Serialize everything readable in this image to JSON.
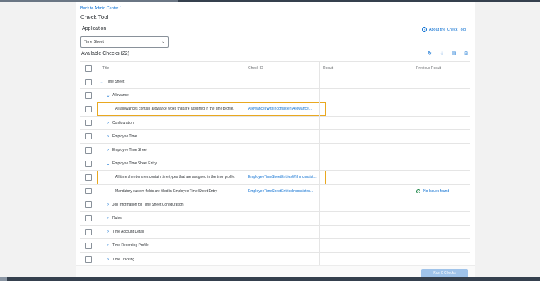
{
  "breadcrumb": "Back to Admin Center /",
  "page_title": "Check Tool",
  "application_label": "Application",
  "about_link": "About the Check Tool",
  "application_select": {
    "value": "Time Sheet"
  },
  "available_checks_title": "Available Checks (22)",
  "columns": {
    "title": "Title",
    "check_id": "Check ID",
    "result": "Result",
    "previous_result": "Previous Result"
  },
  "rows": [
    {
      "title": "Time Sheet",
      "expanded": true
    },
    {
      "title": "Allowance",
      "expanded": true
    },
    {
      "title": "All allowances contain allowance types that are assigned in the time profile.",
      "check_id": "AllowancesWithInconsistentAllowance..."
    },
    {
      "title": "Configuration"
    },
    {
      "title": "Employee Time"
    },
    {
      "title": "Employee Time Sheet"
    },
    {
      "title": "Employee Time Sheet Entry",
      "expanded": true
    },
    {
      "title": "All time sheet entries contain time types that are assigned in the time profile.",
      "check_id": "EmployeeTimeSheetEntriesWithInconsist..."
    },
    {
      "title": "Mandatory custom fields are filled in Employee Time Sheet Entry",
      "check_id": "EmployeeTimeSheetEntriesInconsisten...",
      "previous_result": "No Issues found"
    },
    {
      "title": "Job Information for Time Sheet Configuration"
    },
    {
      "title": "Rules"
    },
    {
      "title": "Time Account Detail"
    },
    {
      "title": "Time Recording Profile"
    },
    {
      "title": "Time Tracking"
    }
  ],
  "footer": {
    "run_button": "Run 0 Checks"
  },
  "colors": {
    "accent": "#0a6ed1",
    "highlight": "#e9a820",
    "success": "#107e3e"
  }
}
